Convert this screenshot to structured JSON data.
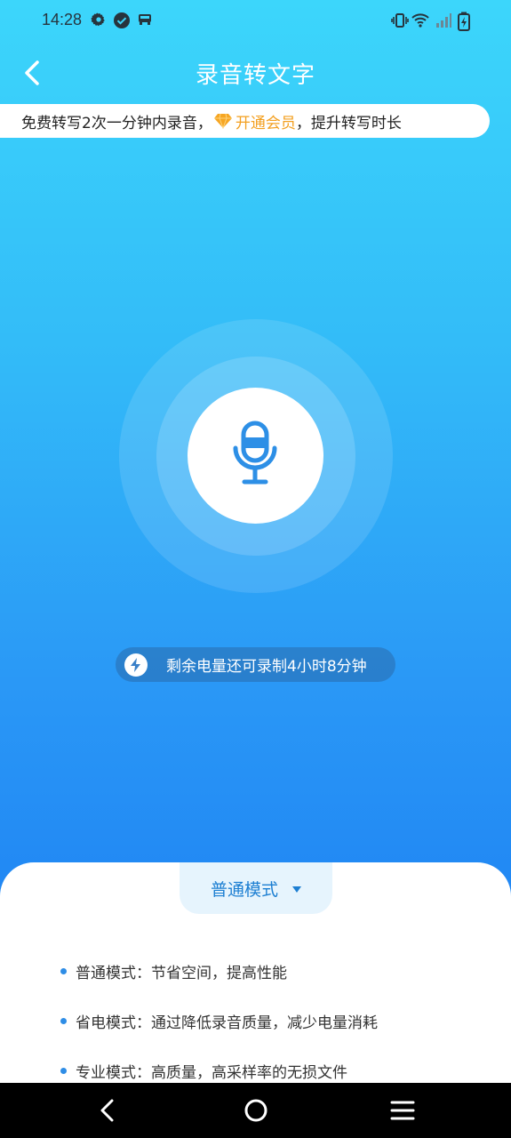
{
  "status_bar": {
    "time": "14:28"
  },
  "header": {
    "title": "录音转文字"
  },
  "promo": {
    "prefix": "免费转写2次一分钟内录音，",
    "vip_link": "开通会员",
    "suffix": "，提升转写时长"
  },
  "battery": {
    "text": "剩余电量还可录制4小时8分钟"
  },
  "mode": {
    "selected": "普通模式",
    "options": [
      {
        "text": "普通模式：节省空间，提高性能"
      },
      {
        "text": "省电模式：通过降低录音质量，减少电量消耗"
      },
      {
        "text": "专业模式：高质量，高采样率的无损文件"
      }
    ]
  },
  "colors": {
    "accent": "#1d7fd2",
    "vip": "#f3a021",
    "gradient_top": "#3cd6fb",
    "gradient_bottom": "#1a79f2"
  },
  "icons": [
    "settings-icon",
    "check-circle-icon",
    "car-icon",
    "vibrate-icon",
    "wifi-icon",
    "signal-icon",
    "battery-charging-icon",
    "back-arrow-icon",
    "diamond-icon",
    "microphone-icon",
    "lightning-icon",
    "caret-down-icon",
    "nav-back-icon",
    "nav-home-icon",
    "nav-menu-icon"
  ]
}
